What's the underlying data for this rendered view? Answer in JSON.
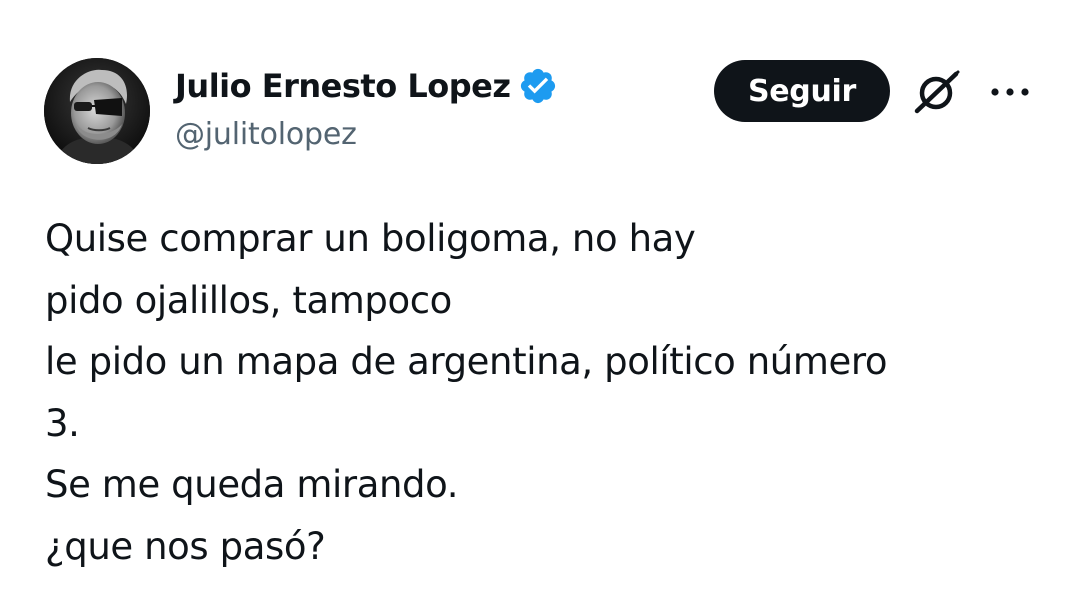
{
  "author": {
    "display_name": "Julio Ernesto Lopez",
    "handle": "@julitolopez",
    "verified": true,
    "avatar_icon": "profile-photo"
  },
  "actions": {
    "follow_label": "Seguir",
    "grok_icon": "grok-icon",
    "more_icon": "more-options-icon"
  },
  "tweet": {
    "lines": [
      "Quise comprar un boligoma, no hay",
      "pido ojalillos, tampoco",
      "le pido un mapa de argentina, político número",
      "3.",
      "Se me queda mirando.",
      "¿que nos pasó?"
    ]
  },
  "colors": {
    "text_primary": "#0f1419",
    "text_secondary": "#536471",
    "verified_blue": "#1d9bf0",
    "button_bg": "#0f1419",
    "button_text": "#ffffff",
    "background": "#ffffff"
  }
}
